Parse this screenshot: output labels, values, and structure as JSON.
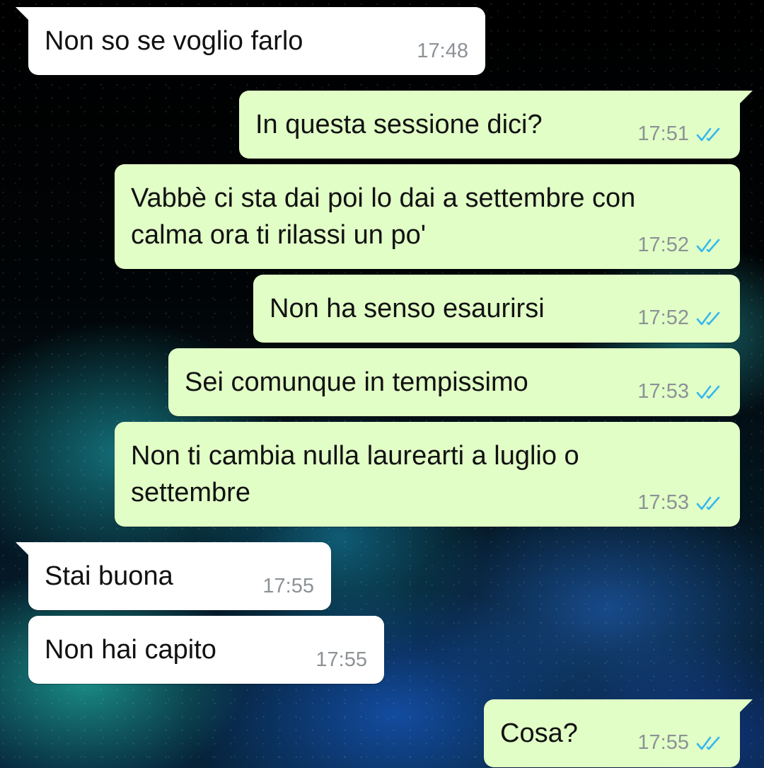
{
  "chat": {
    "messages": [
      {
        "direction": "incoming",
        "lines": [
          "Non so se voglio farlo"
        ],
        "time": "17:48"
      },
      {
        "direction": "outgoing",
        "lines": [
          "In questa sessione dici?"
        ],
        "time": "17:51",
        "status": "read"
      },
      {
        "direction": "outgoing",
        "lines": [
          "Vabbè ci sta dai poi lo dai a settembre con",
          "calma ora ti rilassi un po'"
        ],
        "time": "17:52",
        "status": "read"
      },
      {
        "direction": "outgoing",
        "lines": [
          "Non ha senso esaurirsi"
        ],
        "time": "17:52",
        "status": "read"
      },
      {
        "direction": "outgoing",
        "lines": [
          "Sei comunque in tempissimo"
        ],
        "time": "17:53",
        "status": "read"
      },
      {
        "direction": "outgoing",
        "lines": [
          "Non ti cambia nulla laurearti a luglio o",
          "settembre"
        ],
        "time": "17:53",
        "status": "read"
      },
      {
        "direction": "incoming",
        "lines": [
          "Stai buona"
        ],
        "time": "17:55"
      },
      {
        "direction": "incoming",
        "lines": [
          "Non hai capito"
        ],
        "time": "17:55"
      },
      {
        "direction": "outgoing",
        "lines": [
          "Cosa?"
        ],
        "time": "17:55",
        "status": "read"
      }
    ]
  },
  "colors": {
    "incoming_bubble": "#ffffff",
    "outgoing_bubble": "#e1fec6",
    "read_ticks": "#34b7f1",
    "timestamp": "#8c9296"
  },
  "icons": {
    "read_status": "double-check-icon"
  }
}
